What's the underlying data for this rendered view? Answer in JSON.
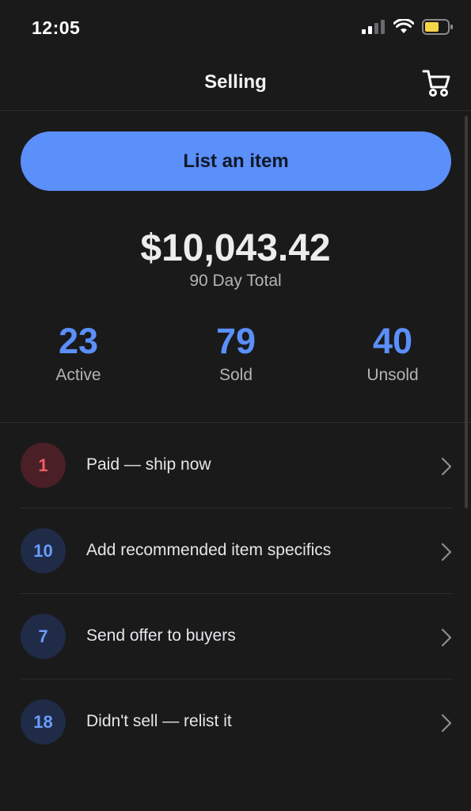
{
  "status_bar": {
    "time": "12:05",
    "icons": [
      "cellular-signal-icon",
      "wifi-icon",
      "battery-icon"
    ],
    "battery_color": "#f5d547"
  },
  "nav": {
    "title": "Selling",
    "cart_icon": "cart-icon"
  },
  "primary_action": {
    "label": "List an item",
    "color": "#5b8ff9"
  },
  "summary": {
    "total_amount": "$10,043.42",
    "total_label": "90 Day Total"
  },
  "stats": [
    {
      "value": "23",
      "label": "Active"
    },
    {
      "value": "79",
      "label": "Sold"
    },
    {
      "value": "40",
      "label": "Unsold"
    }
  ],
  "tasks": [
    {
      "count": "1",
      "label": "Paid — ship now",
      "badge_color": "#f05c6a"
    },
    {
      "count": "10",
      "label": "Add recommended item specifics",
      "badge_color": "#6b9cff"
    },
    {
      "count": "7",
      "label": "Send offer to buyers",
      "badge_color": "#6b9cff"
    },
    {
      "count": "18",
      "label": "Didn't sell — relist it",
      "badge_color": "#6b9cff"
    }
  ]
}
